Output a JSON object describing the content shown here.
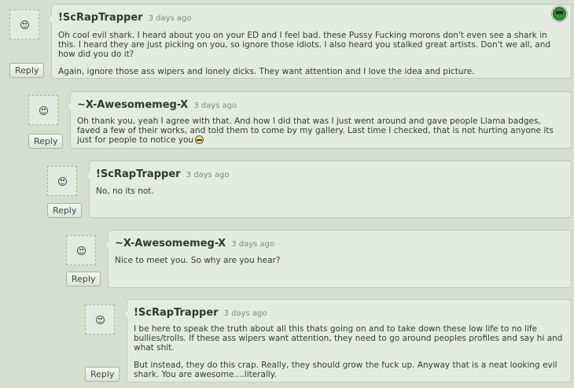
{
  "reply_label": "Reply",
  "comments": [
    {
      "username": "!ScRapTrapper",
      "time": "3 days ago",
      "paragraphs": [
        "Oh cool evil shark. I heard about you on your ED and I feel bad. these Pussy Fucking morons don't even see a shark in this. I heard they are just picking on you, so ignore those idiots. I also heard you stalked great artists. Don't we all, and how did you do it?",
        "Again, ignore those ass wipers and lonely dicks. They want attention and I love the idea and picture."
      ]
    },
    {
      "username": "~X-Awesomemeg-X",
      "time": "3 days ago",
      "paragraphs": [
        "Oh thank you, yeah I agree with that. And how I did that was I just went around and gave people Llama badges, faved a few of their works, and told them to come by my gallery. Last time I checked, that is not hurting anyone its just for people to notice you"
      ]
    },
    {
      "username": "!ScRapTrapper",
      "time": "3 days ago",
      "paragraphs": [
        "No, no its not."
      ]
    },
    {
      "username": "~X-Awesomemeg-X",
      "time": "3 days ago",
      "paragraphs": [
        "Nice to meet you. So why are you hear?"
      ]
    },
    {
      "username": "!ScRapTrapper",
      "time": "3 days ago",
      "paragraphs": [
        "I be here to speak the truth about all this thats going on and to take down these low life to no life bullies/trolls. If these ass wipers want attention, they need to go around peoples profiles and say hi and what shit.",
        "But instead, they do this crap. Really, they should grow the fuck up. Anyway that is a neat looking evil shark. You are awesome....literally."
      ]
    }
  ]
}
